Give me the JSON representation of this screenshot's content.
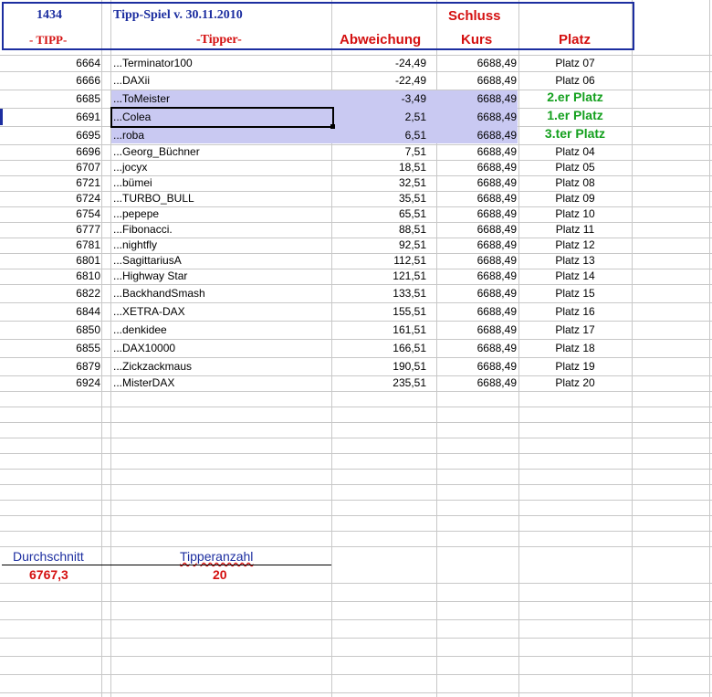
{
  "header": {
    "id": "1434",
    "title": "Tipp-Spiel v. 30.11.2010",
    "schluss": "Schluss",
    "col_tipp": "- TIPP-",
    "col_tipper": "-Tipper-",
    "col_abweichung": "Abweichung",
    "col_kurs": "Kurs",
    "col_platz": "Platz"
  },
  "rows": [
    {
      "tipp": "6664",
      "tipper": "...Terminator100",
      "abw": "-24,49",
      "kurs": "6688,49",
      "platz": "Platz 07"
    },
    {
      "tipp": "6666",
      "tipper": "...DAXii",
      "abw": "-22,49",
      "kurs": "6688,49",
      "platz": "Platz 06"
    },
    {
      "tipp": "6685",
      "tipper": "...ToMeister",
      "abw": "-3,49",
      "kurs": "6688,49",
      "platz": "2.er Platz"
    },
    {
      "tipp": "6691",
      "tipper": "...Colea",
      "abw": "2,51",
      "kurs": "6688,49",
      "platz": "1.er Platz"
    },
    {
      "tipp": "6695",
      "tipper": "...roba",
      "abw": "6,51",
      "kurs": "6688,49",
      "platz": "3.ter Platz"
    },
    {
      "tipp": "6696",
      "tipper": "...Georg_Büchner",
      "abw": "7,51",
      "kurs": "6688,49",
      "platz": "Platz 04"
    },
    {
      "tipp": "6707",
      "tipper": "...jocyx",
      "abw": "18,51",
      "kurs": "6688,49",
      "platz": "Platz 05"
    },
    {
      "tipp": "6721",
      "tipper": "...bümei",
      "abw": "32,51",
      "kurs": "6688,49",
      "platz": "Platz 08"
    },
    {
      "tipp": "6724",
      "tipper": "...TURBO_BULL",
      "abw": "35,51",
      "kurs": "6688,49",
      "platz": "Platz 09"
    },
    {
      "tipp": "6754",
      "tipper": "...pepepe",
      "abw": "65,51",
      "kurs": "6688,49",
      "platz": "Platz 10"
    },
    {
      "tipp": "6777",
      "tipper": "...Fibonacci.",
      "abw": "88,51",
      "kurs": "6688,49",
      "platz": "Platz 11"
    },
    {
      "tipp": "6781",
      "tipper": "...nightfly",
      "abw": "92,51",
      "kurs": "6688,49",
      "platz": "Platz 12"
    },
    {
      "tipp": "6801",
      "tipper": "...SagittariusA",
      "abw": "112,51",
      "kurs": "6688,49",
      "platz": "Platz 13"
    },
    {
      "tipp": "6810",
      "tipper": "...Highway Star",
      "abw": "121,51",
      "kurs": "6688,49",
      "platz": "Platz 14"
    },
    {
      "tipp": "6822",
      "tipper": "...BackhandSmash",
      "abw": "133,51",
      "kurs": "6688,49",
      "platz": "Platz 15"
    },
    {
      "tipp": "6844",
      "tipper": "...XETRA-DAX",
      "abw": "155,51",
      "kurs": "6688,49",
      "platz": "Platz 16"
    },
    {
      "tipp": "6850",
      "tipper": "...denkidee",
      "abw": "161,51",
      "kurs": "6688,49",
      "platz": "Platz 17"
    },
    {
      "tipp": "6855",
      "tipper": "...DAX10000",
      "abw": "166,51",
      "kurs": "6688,49",
      "platz": "Platz 18"
    },
    {
      "tipp": "6879",
      "tipper": "...Zickzackmaus",
      "abw": "190,51",
      "kurs": "6688,49",
      "platz": "Platz 19"
    },
    {
      "tipp": "6924",
      "tipper": "...MisterDAX",
      "abw": "235,51",
      "kurs": "6688,49",
      "platz": "Platz 20"
    }
  ],
  "summary": {
    "durchschnitt_label": "Durchschnitt",
    "durchschnitt_value": "6767,3",
    "tipperanzahl_label": "Tipperanzahl",
    "tipperanzahl_value": "20"
  },
  "colors": {
    "header_blue": "#1c2ea0",
    "header_red": "#d41010",
    "winner_green": "#14a01e",
    "highlight": "#c9c9f2"
  }
}
